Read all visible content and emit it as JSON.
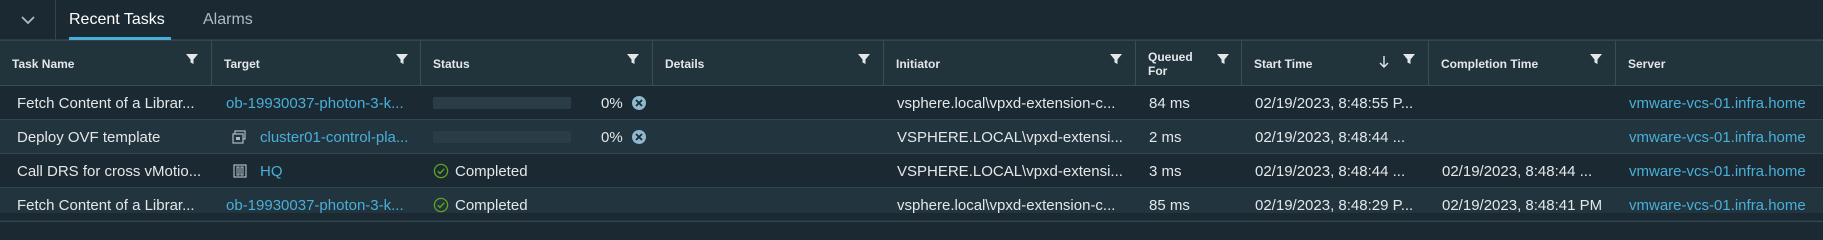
{
  "tabs": [
    {
      "label": "Recent Tasks"
    },
    {
      "label": "Alarms"
    }
  ],
  "columns": {
    "task_name": "Task Name",
    "target": "Target",
    "status": "Status",
    "details": "Details",
    "initiator": "Initiator",
    "queued_for": "Queued For",
    "start_time": "Start Time",
    "completion_time": "Completion Time",
    "server": "Server"
  },
  "rows": [
    {
      "task_name": "Fetch Content of a Librar...",
      "target": "ob-19930037-photon-3-k...",
      "status_percent": "0%",
      "details": "",
      "initiator": "vsphere.local\\vpxd-extension-c...",
      "queued_for": "84 ms",
      "start_time": "02/19/2023, 8:48:55 P...",
      "completion_time": "",
      "server": "vmware-vcs-01.infra.home"
    },
    {
      "task_name": "Deploy OVF template",
      "target": "cluster01-control-pla...",
      "status_percent": "0%",
      "details": "",
      "initiator": "VSPHERE.LOCAL\\vpxd-extensi...",
      "queued_for": "2 ms",
      "start_time": "02/19/2023, 8:48:44 ...",
      "completion_time": "",
      "server": "vmware-vcs-01.infra.home"
    },
    {
      "task_name": "Call DRS for cross vMotio...",
      "target": "HQ",
      "status": "Completed",
      "details": "",
      "initiator": "VSPHERE.LOCAL\\vpxd-extensi...",
      "queued_for": "3 ms",
      "start_time": "02/19/2023, 8:48:44 ...",
      "completion_time": "02/19/2023, 8:48:44 ...",
      "server": "vmware-vcs-01.infra.home"
    },
    {
      "task_name": "Fetch Content of a Librar...",
      "target": "ob-19930037-photon-3-k...",
      "status": "Completed",
      "details": "",
      "initiator": "vsphere.local\\vpxd-extension-c...",
      "queued_for": "85 ms",
      "start_time": "02/19/2023, 8:48:29 P...",
      "completion_time": "02/19/2023, 8:48:41 PM",
      "server": "vmware-vcs-01.infra.home"
    }
  ],
  "colors": {
    "accent": "#49afd9",
    "success": "#62a420",
    "background": "#1b2a32",
    "header_bg": "#21333b"
  }
}
